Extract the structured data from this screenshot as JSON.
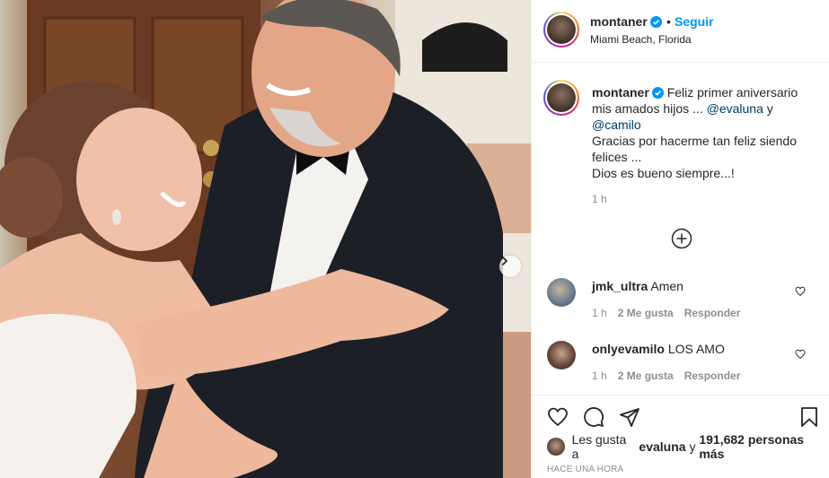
{
  "post": {
    "username": "montaner",
    "follow_label": "Seguir",
    "separator": "•",
    "location": "Miami Beach, Florida"
  },
  "caption": {
    "username": "montaner",
    "line1": "Feliz primer aniversario mis amados hijos ... ",
    "mention1": "@evaluna",
    "and": " y ",
    "mention2": "@camilo",
    "line2": "Gracias por hacerme tan feliz siendo felices ...",
    "line3": "Dios es bueno siempre...!",
    "time": "1 h"
  },
  "comments": [
    {
      "username": "jmk_ultra",
      "text": "Amen",
      "time": "1 h",
      "likes": "2 Me gusta",
      "reply": "Responder"
    },
    {
      "username": "onlyevamilo",
      "text": "LOS AMO",
      "time": "1 h",
      "likes": "2 Me gusta",
      "reply": "Responder"
    }
  ],
  "likes": {
    "prefix": "Les gusta a ",
    "user": "evaluna",
    "middle": " y ",
    "count": "191,682 personas más"
  },
  "timeago": "HACE UNA HORA",
  "colors": {
    "accent": "#0095f6",
    "mention": "#00376b",
    "muted": "#8e8e8e"
  },
  "icons": [
    "verified-badge-icon",
    "add-circle-icon",
    "heart-icon",
    "comment-icon",
    "share-icon",
    "bookmark-icon",
    "chevron-right-icon"
  ]
}
